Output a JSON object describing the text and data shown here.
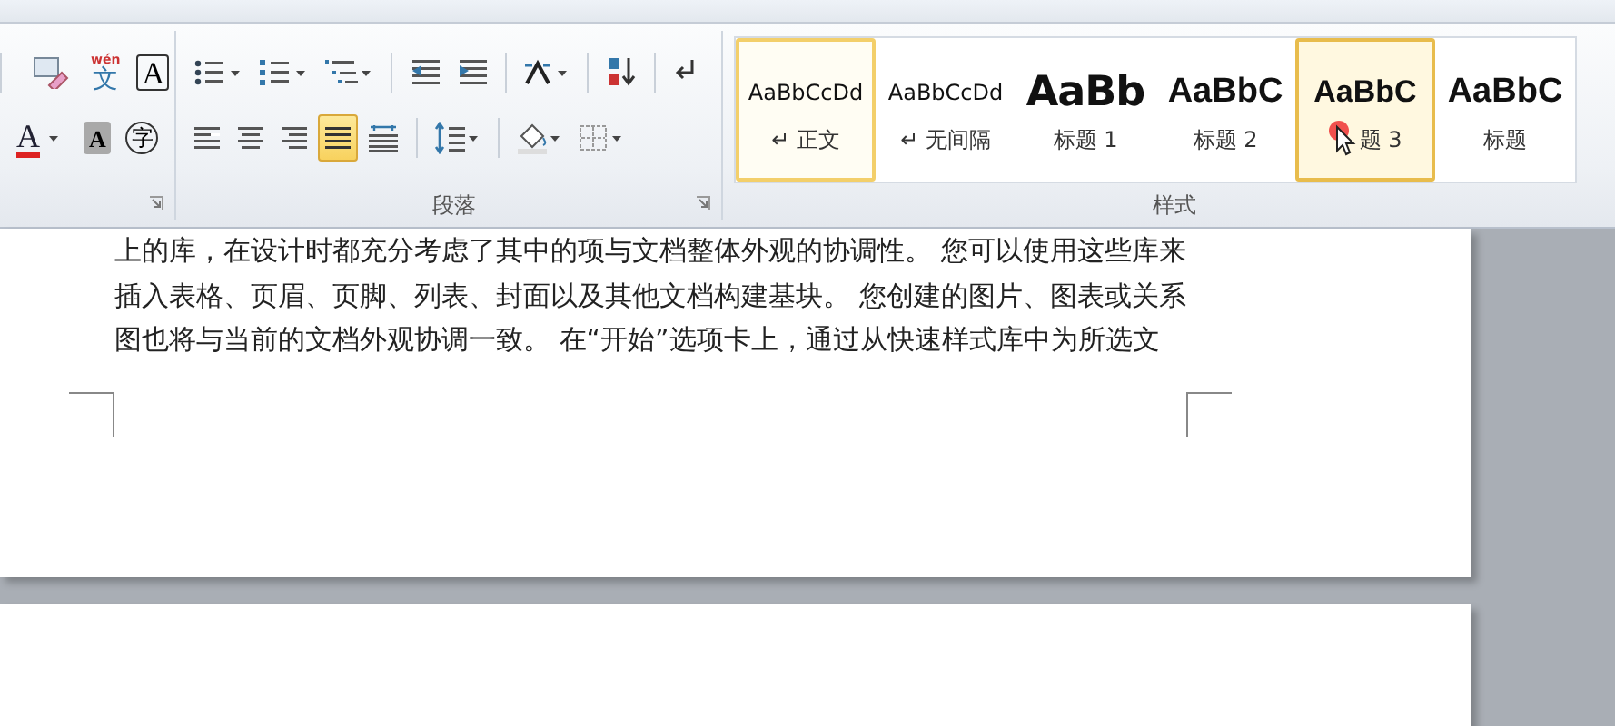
{
  "font_group": {
    "row1": [
      {
        "kind": "clear-format"
      },
      {
        "kind": "phonetic",
        "glyph": "文",
        "ruby": "wén"
      },
      {
        "kind": "boxed",
        "glyph": "A"
      }
    ],
    "row2": [
      {
        "kind": "font-color",
        "glyph": "A"
      },
      {
        "kind": "shade",
        "glyph": "A"
      },
      {
        "kind": "enclose",
        "glyph": "字"
      }
    ]
  },
  "paragraph_group": {
    "label": "段落",
    "row1": [
      {
        "kind": "bullets"
      },
      {
        "kind": "numbering"
      },
      {
        "kind": "multilevel"
      },
      {
        "kind": "sep"
      },
      {
        "kind": "outdent"
      },
      {
        "kind": "indent"
      },
      {
        "kind": "sep"
      },
      {
        "kind": "layout"
      },
      {
        "kind": "sep"
      },
      {
        "kind": "sort"
      },
      {
        "kind": "sep"
      },
      {
        "kind": "marks"
      }
    ],
    "row2": [
      {
        "kind": "align-left",
        "selected": false
      },
      {
        "kind": "align-center",
        "selected": false
      },
      {
        "kind": "align-right",
        "selected": false
      },
      {
        "kind": "justify",
        "selected": true
      },
      {
        "kind": "distribute",
        "selected": false
      },
      {
        "kind": "sep"
      },
      {
        "kind": "spacing"
      },
      {
        "kind": "sep"
      },
      {
        "kind": "fill"
      },
      {
        "kind": "borders"
      }
    ]
  },
  "styles_group": {
    "label": "样式",
    "items": [
      {
        "preview": "AaBbCcDd",
        "label": "↵ 正文",
        "kind": "normal",
        "selected": true,
        "hovered": false
      },
      {
        "preview": "AaBbCcDd",
        "label": "↵ 无间隔",
        "kind": "normal",
        "selected": false,
        "hovered": false
      },
      {
        "preview": "AaBb",
        "label": "标题 1",
        "kind": "heading1",
        "selected": false,
        "hovered": false
      },
      {
        "preview": "AaBbC",
        "label": "标题 2",
        "kind": "heading2",
        "selected": false,
        "hovered": false
      },
      {
        "preview": "AaBbC",
        "label": "题 3",
        "kind": "heading3",
        "selected": false,
        "hovered": true
      },
      {
        "preview": "AaBbC",
        "label": "标题",
        "kind": "title",
        "selected": false,
        "hovered": false
      }
    ]
  },
  "document": {
    "lines": [
      "上的库，在设计时都充分考虑了其中的项与文档整体外观的协调性。 您可以使用这些库来",
      "插入表格、页眉、页脚、列表、封面以及其他文档构建基块。 您创建的图片、图表或关系",
      "图也将与当前的文档外观协调一致。 在“开始”选项卡上，通过从快速样式库中为所选文"
    ]
  }
}
